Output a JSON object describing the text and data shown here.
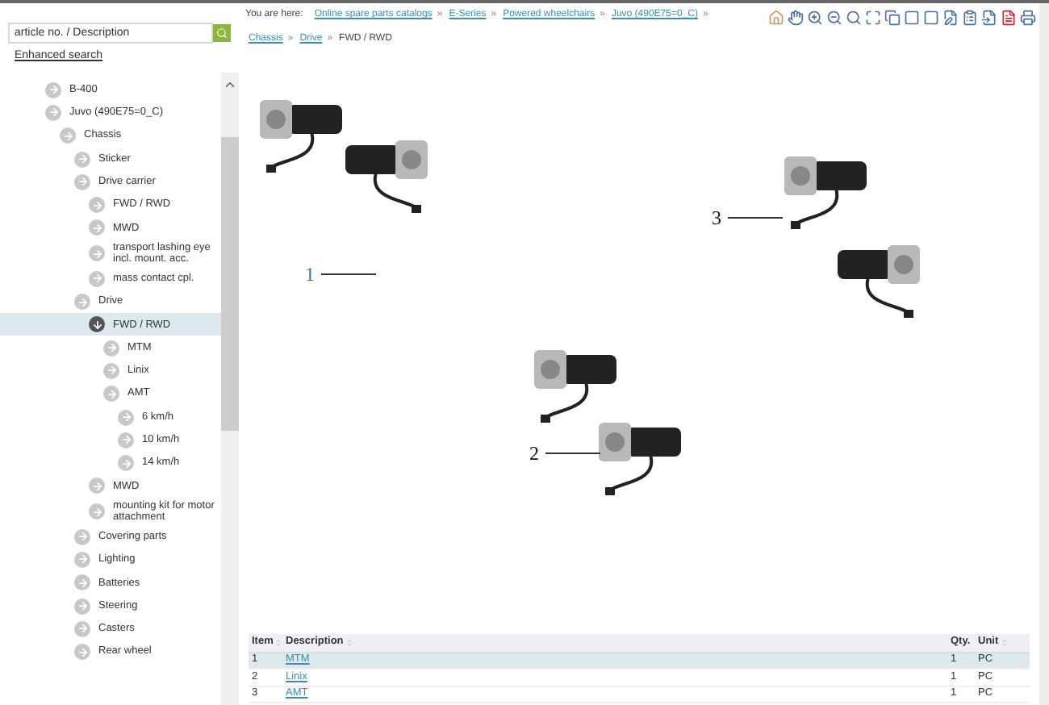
{
  "search": {
    "placeholder": "article no. / Description"
  },
  "enhanced_search": "Enhanced search",
  "tree": [
    {
      "label": "B-400",
      "selected": false
    },
    {
      "label": "Juvo (490E75=0_C)",
      "selected": false,
      "children": [
        {
          "label": "Chassis",
          "selected": false,
          "children": [
            {
              "label": "Sticker",
              "selected": false
            },
            {
              "label": "Drive carrier",
              "selected": false,
              "children": [
                {
                  "label": "FWD / RWD",
                  "selected": false
                },
                {
                  "label": "MWD",
                  "selected": false
                },
                {
                  "label": "transport lashing eye incl. mount. acc.",
                  "selected": false
                },
                {
                  "label": "mass contact cpl.",
                  "selected": false
                }
              ]
            },
            {
              "label": "Drive",
              "selected": false,
              "children": [
                {
                  "label": "FWD / RWD",
                  "selected": true,
                  "children": [
                    {
                      "label": "MTM",
                      "selected": false
                    },
                    {
                      "label": "Linix",
                      "selected": false
                    },
                    {
                      "label": "AMT",
                      "selected": false,
                      "children": [
                        {
                          "label": "6 km/h",
                          "selected": false
                        },
                        {
                          "label": "10 km/h",
                          "selected": false
                        },
                        {
                          "label": "14 km/h",
                          "selected": false
                        }
                      ]
                    }
                  ]
                },
                {
                  "label": "MWD",
                  "selected": false
                },
                {
                  "label": "mounting kit for motor attachment",
                  "selected": false
                }
              ]
            },
            {
              "label": "Covering parts",
              "selected": false
            },
            {
              "label": "Lighting",
              "selected": false
            },
            {
              "label": "Batteries",
              "selected": false
            },
            {
              "label": "Steering",
              "selected": false
            },
            {
              "label": "Casters",
              "selected": false
            },
            {
              "label": "Rear wheel",
              "selected": false
            }
          ]
        }
      ]
    }
  ],
  "breadcrumb": {
    "prefix": "You are here:",
    "items": [
      {
        "label": "Online spare parts catalogs",
        "link": true,
        "sep": "»"
      },
      {
        "label": "E-Series",
        "link": true,
        "sep": "»"
      },
      {
        "label": "Powered wheelchairs",
        "link": true,
        "sep": "»"
      },
      {
        "label": "Juvo (490E75=0_C)",
        "link": true,
        "sep": "»"
      },
      {
        "label": "Chassis",
        "link": true,
        "sep": "»"
      },
      {
        "label": "Drive",
        "link": true,
        "sep": "»"
      },
      {
        "label": "FWD / RWD",
        "link": false
      }
    ]
  },
  "callouts": [
    {
      "label": "1",
      "selected": true
    },
    {
      "label": "2",
      "selected": false
    },
    {
      "label": "3",
      "selected": false
    }
  ],
  "table": {
    "columns": [
      "Item",
      "Description",
      "Qty.",
      "Unit"
    ],
    "rows": [
      {
        "item": "1",
        "description": "MTM",
        "qty": "1",
        "unit": "PC",
        "selected": true
      },
      {
        "item": "2",
        "description": "Linix",
        "qty": "1",
        "unit": "PC",
        "selected": false
      },
      {
        "item": "3",
        "description": "AMT",
        "qty": "1",
        "unit": "PC",
        "selected": false
      }
    ]
  }
}
